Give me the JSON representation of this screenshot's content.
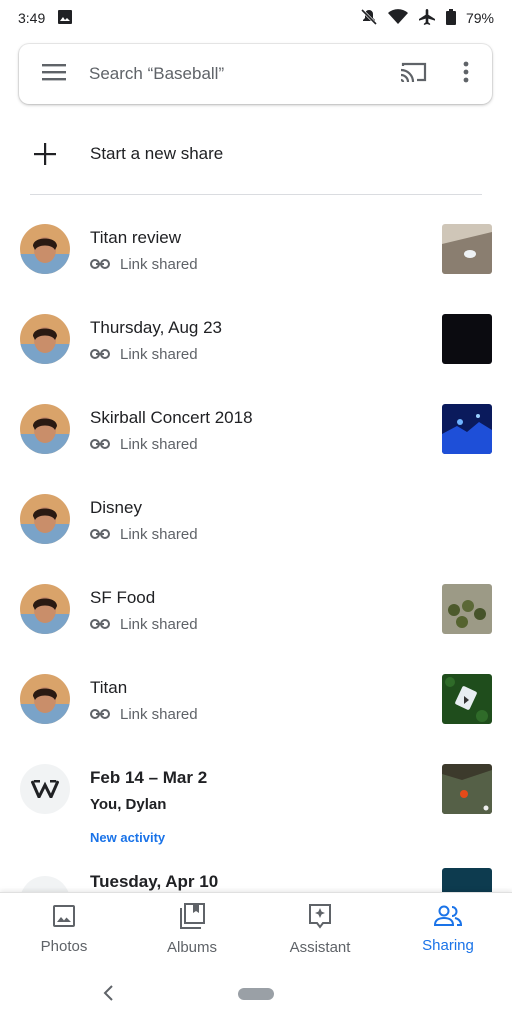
{
  "status": {
    "time": "3:49",
    "battery": "79%"
  },
  "search": {
    "placeholder": "Search “Baseball”"
  },
  "new_share": {
    "label": "Start a new share"
  },
  "shares": [
    {
      "title": "Titan review",
      "subtitle": "Link shared"
    },
    {
      "title": "Thursday, Aug 23",
      "subtitle": "Link shared"
    },
    {
      "title": "Skirball Concert 2018",
      "subtitle": "Link shared"
    },
    {
      "title": "Disney",
      "subtitle": "Link shared"
    },
    {
      "title": "SF Food",
      "subtitle": "Link shared"
    },
    {
      "title": "Titan",
      "subtitle": "Link shared"
    },
    {
      "title": "Feb 14 – Mar 2",
      "subtitle": "You, Dylan",
      "activity": "New activity"
    },
    {
      "title": "Tuesday, Apr 10"
    }
  ],
  "nav": {
    "photos": "Photos",
    "albums": "Albums",
    "assistant": "Assistant",
    "sharing": "Sharing",
    "active": "sharing",
    "active_color": "#1a73e8"
  },
  "icons": [
    "image-icon",
    "notifications-off-icon",
    "wifi-icon",
    "airplane-icon",
    "battery-icon",
    "menu-icon",
    "cast-icon",
    "more-vert-icon",
    "plus-icon",
    "link-icon",
    "chevron-left-icon"
  ]
}
